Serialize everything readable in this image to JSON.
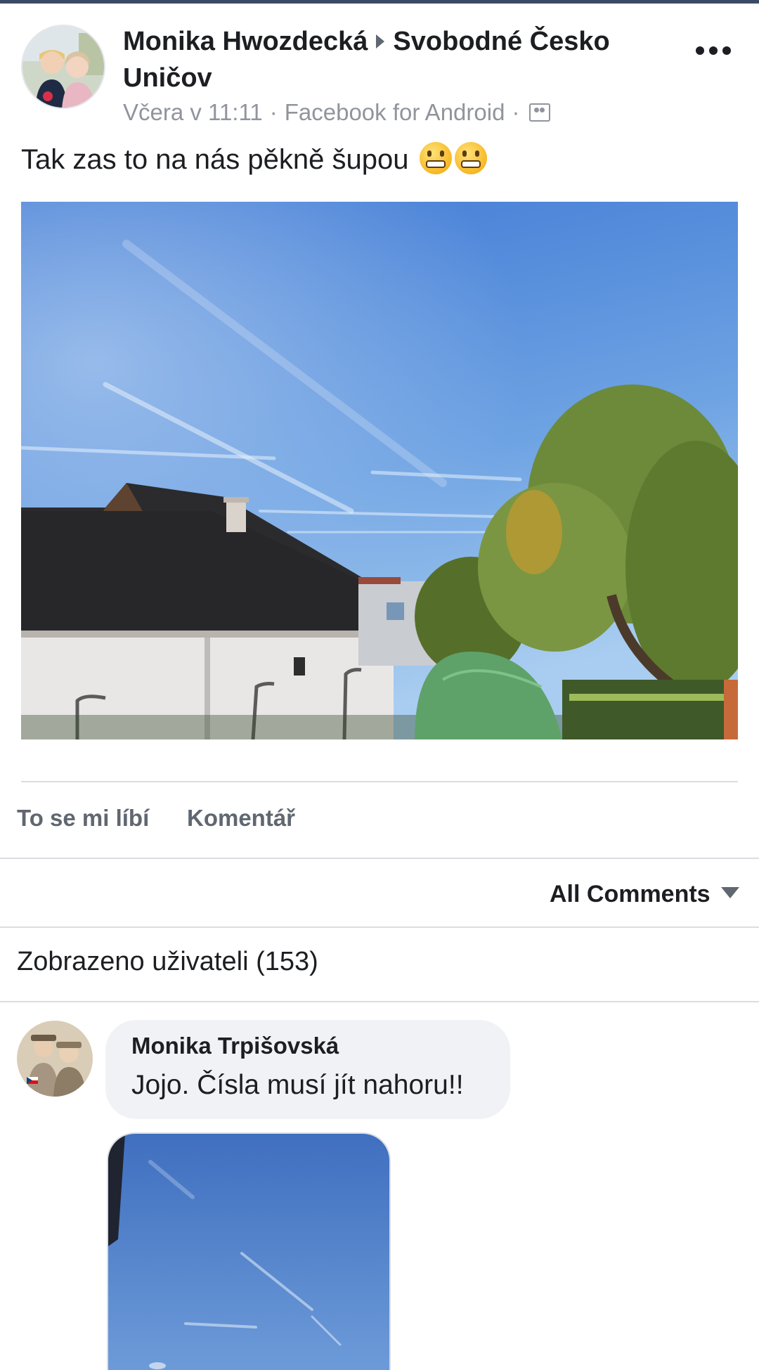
{
  "post": {
    "author": "Monika Hwozdecká",
    "group": "Svobodné Česko Uničov",
    "timestamp": "Včera v 11:11",
    "source": "Facebook for Android",
    "audience_icon": "group-icon",
    "more_icon": "more-dots-icon",
    "text": "Tak zas to na nás pěkně šupou",
    "emojis": [
      "grimacing-emoji",
      "grimacing-emoji"
    ]
  },
  "actions": {
    "like_label": "To se mi líbí",
    "comment_label": "Komentář"
  },
  "comments_sort": {
    "label": "All Comments",
    "icon": "caret-down-icon"
  },
  "seen_by": "Zobrazeno uživateli (153)",
  "comments": [
    {
      "author": "Monika Trpišovská",
      "text": "Jojo. Čísla musí jít nahoru!!"
    }
  ],
  "colors": {
    "sky": "#3f7ad0",
    "text_primary": "#1c1e21",
    "text_secondary": "#90949c",
    "action_gray": "#606770",
    "bubble_bg": "#f0f2f5",
    "divider": "#dadde1"
  }
}
